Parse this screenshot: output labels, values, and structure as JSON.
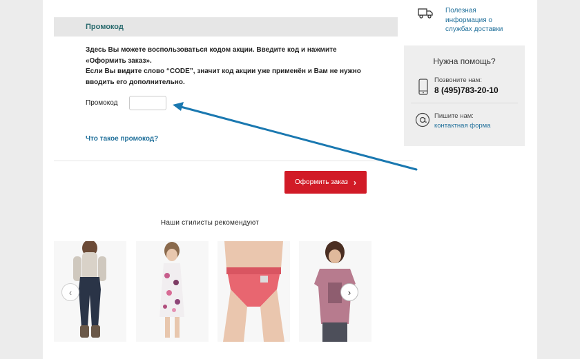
{
  "promo": {
    "header": "Промокод",
    "text_line1": "Здесь Вы можете воспользоваться кодом акции. Введите код и нажмите",
    "text_line2": "«Оформить заказ».",
    "text_line3": "Если Вы видите слово “CODE”, значит код акции уже применён и Вам не нужно",
    "text_line4": "вводить его дополнительно.",
    "field_label": "Промокод",
    "field_value": "",
    "help_link": "Что такое промокод?"
  },
  "order": {
    "button_label": "Оформить заказ",
    "button_color": "#d11b27"
  },
  "recommendations": {
    "title": "Наши стилисты рекомендуют",
    "products": [
      {
        "name": "jeans"
      },
      {
        "name": "floral-dress"
      },
      {
        "name": "coral-briefs"
      },
      {
        "name": "pink-tshirt"
      }
    ]
  },
  "sidebar": {
    "delivery_link": "Полезная информация о службах доставки",
    "help_title": "Нужна помощь?",
    "call_label": "Позвоните нам:",
    "phone": "8 (495)783-20-10",
    "write_label": "Пишите нам:",
    "contact_link": "контактная форма"
  },
  "colors": {
    "accent": "#d11b27",
    "link": "#1f6f9a",
    "header_teal": "#2a6b6e",
    "annotation_arrow": "#1a78b0"
  }
}
